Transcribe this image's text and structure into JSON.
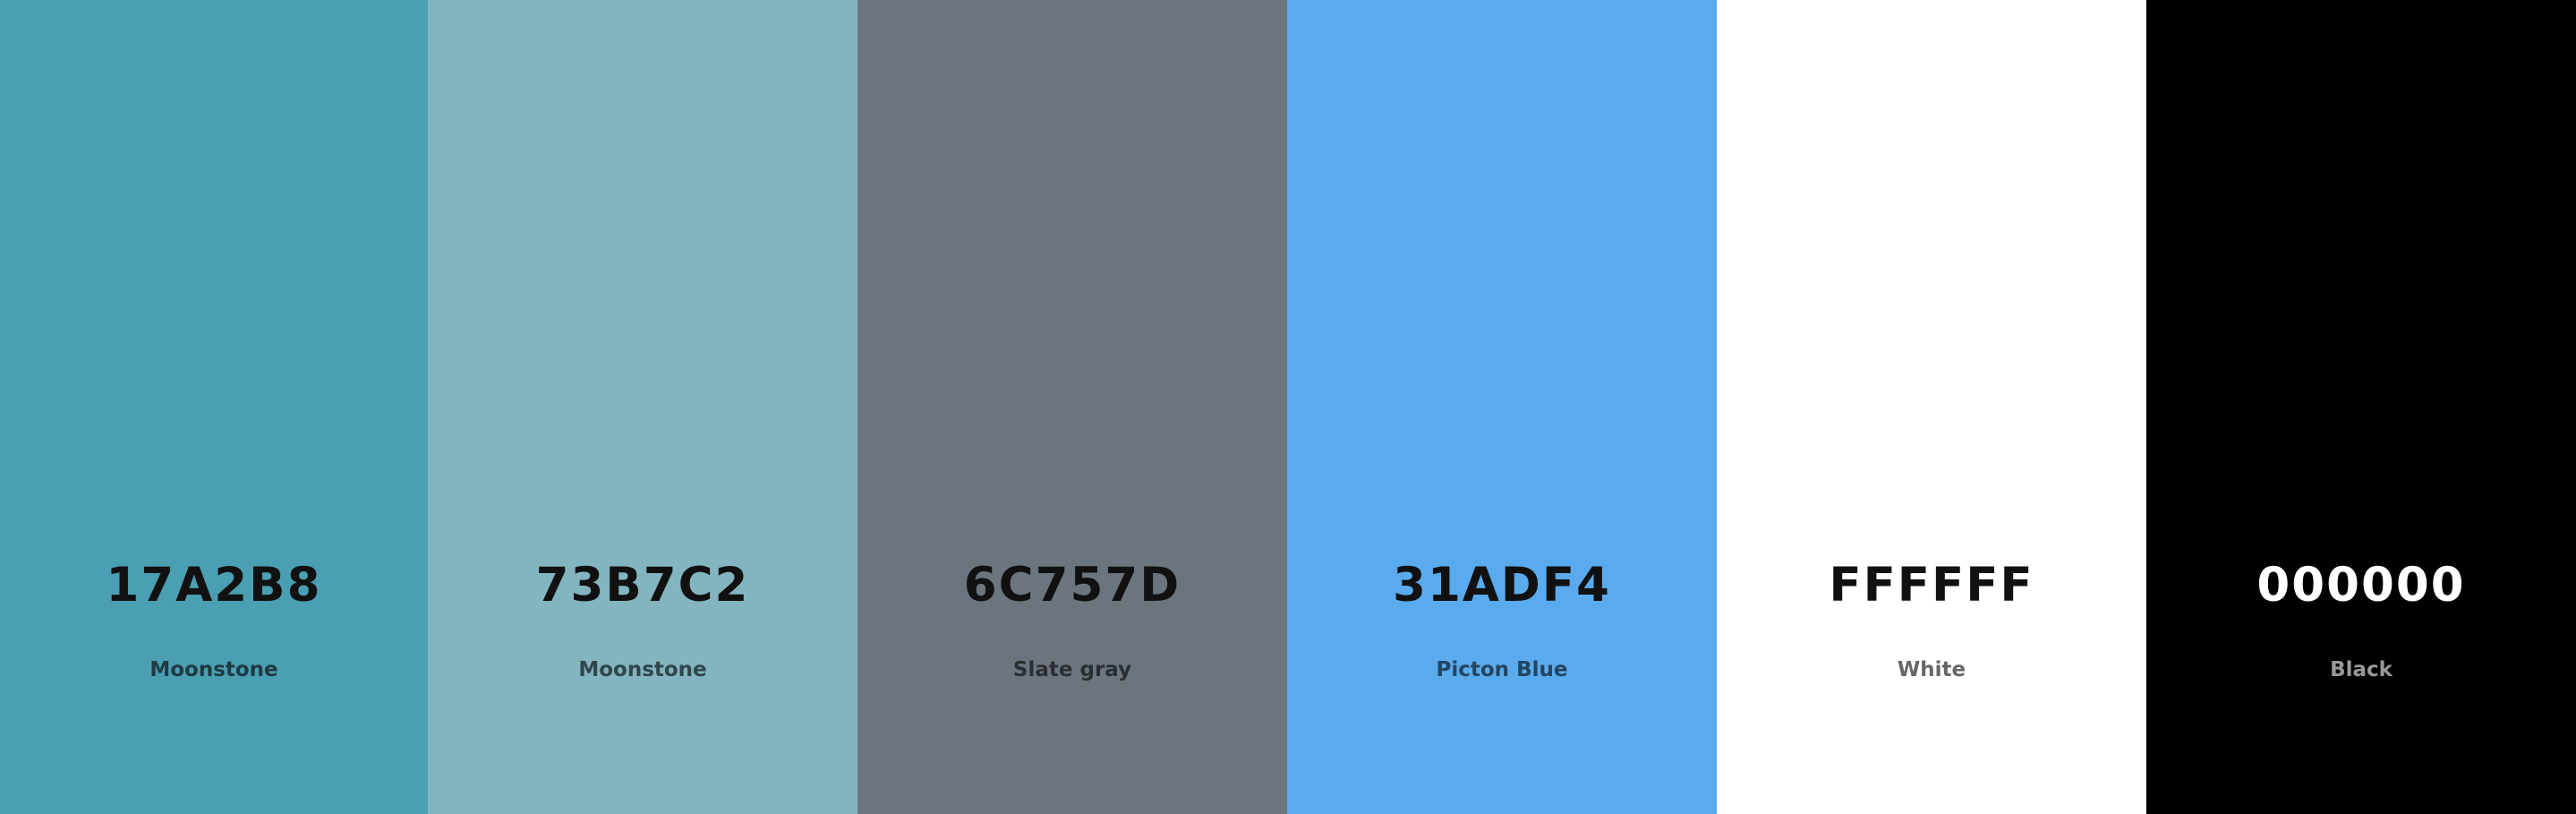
{
  "palette": {
    "swatches": [
      {
        "hex": "17A2B8",
        "name": "Moonstone",
        "fill": "#4a9fb3",
        "hex_color": "#111111",
        "name_color": "#1f3a40"
      },
      {
        "hex": "73B7C2",
        "name": "Moonstone",
        "fill": "#83b5c0",
        "hex_color": "#111111",
        "name_color": "#2f474c"
      },
      {
        "hex": "6C757D",
        "name": "Slate gray",
        "fill": "#6c757d",
        "hex_color": "#111111",
        "name_color": "#2a2e31"
      },
      {
        "hex": "31ADF4",
        "name": "Picton Blue",
        "fill": "#5aabed",
        "hex_color": "#111111",
        "name_color": "#244560"
      },
      {
        "hex": "FFFFFF",
        "name": "White",
        "fill": "#ffffff",
        "hex_color": "#111111",
        "name_color": "#666666"
      },
      {
        "hex": "000000",
        "name": "Black",
        "fill": "#000000",
        "hex_color": "#ffffff",
        "name_color": "#999999"
      }
    ]
  }
}
